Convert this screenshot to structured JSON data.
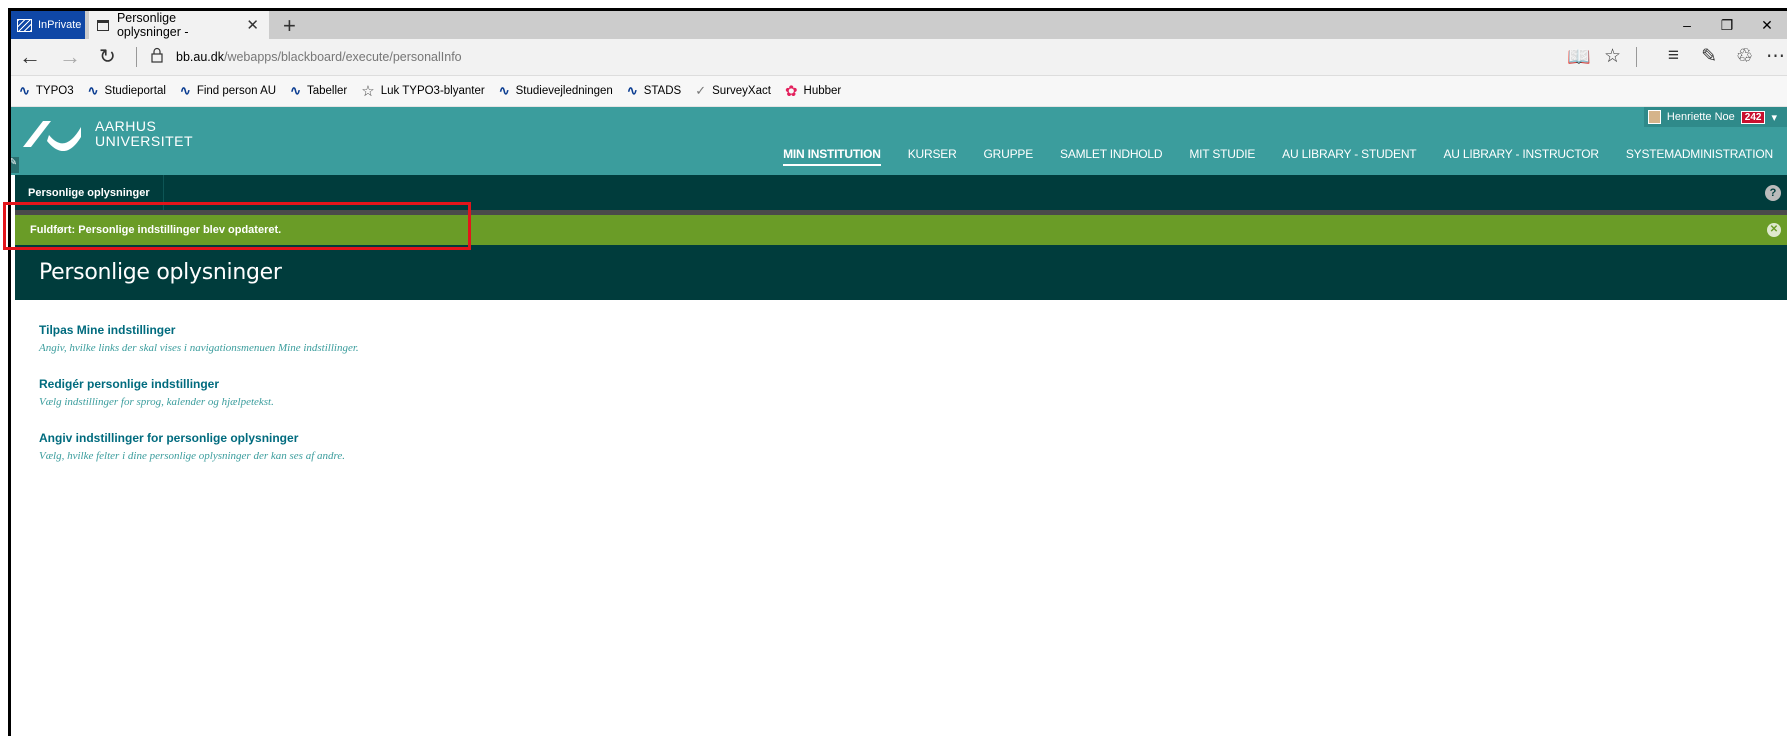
{
  "browser": {
    "inprivate_label": "InPrivate",
    "tab_title": "Personlige oplysninger -",
    "tab_close": "✕",
    "new_tab": "+",
    "url_domain": "bb.au.dk",
    "url_path": "/webapps/blackboard/execute/personalInfo",
    "window": {
      "minimize": "–",
      "restore": "❐",
      "close": "✕"
    }
  },
  "favorites": [
    {
      "label": "TYPO3",
      "icon": "au-wave-icon"
    },
    {
      "label": "Studieportal",
      "icon": "au-wave-icon"
    },
    {
      "label": "Find person AU",
      "icon": "au-wave-icon"
    },
    {
      "label": "Tabeller",
      "icon": "au-wave-icon"
    },
    {
      "label": "Luk TYPO3-blyanter",
      "icon": "star-icon"
    },
    {
      "label": "Studievejledningen",
      "icon": "au-wave-icon"
    },
    {
      "label": "STADS",
      "icon": "au-wave-icon"
    },
    {
      "label": "SurveyXact",
      "icon": "check-icon"
    },
    {
      "label": "Hubber",
      "icon": "hubber-icon"
    }
  ],
  "header": {
    "logo_line1": "AARHUS",
    "logo_line2": "UNIVERSITET",
    "user_name": "Henriette Noe",
    "user_badge": "242",
    "nav": [
      {
        "label": "MIN INSTITUTION",
        "active": true
      },
      {
        "label": "KURSER",
        "active": false
      },
      {
        "label": "GRUPPE",
        "active": false
      },
      {
        "label": "SAMLET INDHOLD",
        "active": false
      },
      {
        "label": "MIT STUDIE",
        "active": false
      },
      {
        "label": "AU LIBRARY - STUDENT",
        "active": false
      },
      {
        "label": "AU LIBRARY - INSTRUCTOR",
        "active": false
      },
      {
        "label": "SYSTEMADMINISTRATION",
        "active": false
      }
    ]
  },
  "breadcrumb": {
    "label": "Personlige oplysninger",
    "help": "?"
  },
  "success": {
    "message": "Fuldført: Personlige indstillinger blev opdateret.",
    "close": "✕"
  },
  "page": {
    "title": "Personlige oplysninger",
    "items": [
      {
        "link": "Tilpas Mine indstillinger",
        "desc": "Angiv, hvilke links der skal vises i navigationsmenuen Mine indstillinger."
      },
      {
        "link": "Redigér personlige indstillinger",
        "desc": "Vælg indstillinger for sprog, kalender og hjælpetekst."
      },
      {
        "link": "Angiv indstillinger for personlige oplysninger",
        "desc": "Vælg, hvilke felter i dine personlige oplysninger der kan ses af andre."
      }
    ]
  },
  "colors": {
    "au_teal": "#3b9d9d",
    "dark_teal": "#003c3c",
    "success_green": "#6a9c27",
    "highlight_red": "#e3151b",
    "link": "#006b7e"
  }
}
